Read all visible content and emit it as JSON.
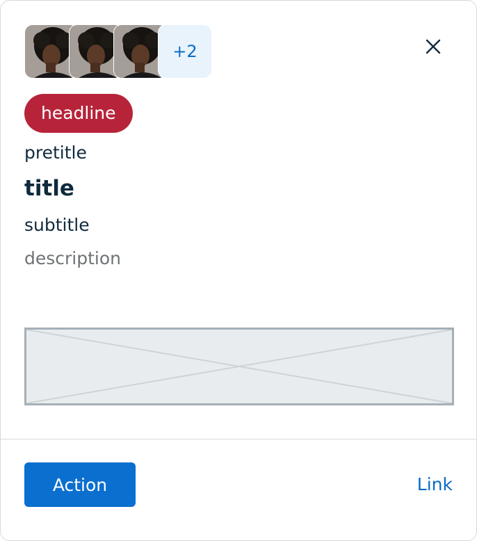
{
  "avatars": {
    "count_visible": 3,
    "overflow_label": "+2"
  },
  "close_icon": "close-icon",
  "headline": "headline",
  "pretitle": "pretitle",
  "title": "title",
  "subtitle": "subtitle",
  "description": "description",
  "image_placeholder": "image-placeholder-icon",
  "footer": {
    "action_label": "Action",
    "link_label": "Link"
  },
  "colors": {
    "headline_bg": "#b7243a",
    "primary": "#0b6fcf",
    "link": "#0b6bc5",
    "avatar_more_bg": "#e8f3fc",
    "text": "#102a3d",
    "muted": "#6f7375"
  }
}
